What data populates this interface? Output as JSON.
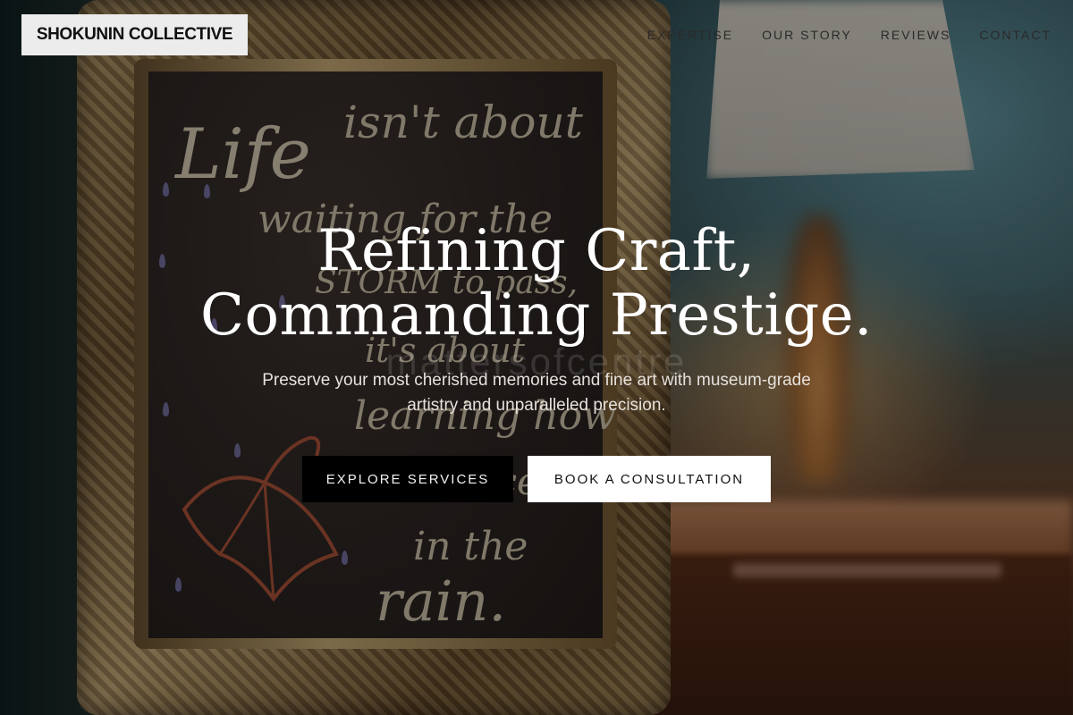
{
  "brand": {
    "name": "SHOKUNIN COLLECTIVE"
  },
  "nav": {
    "items": [
      {
        "label": "EXPERTISE"
      },
      {
        "label": "OUR STORY"
      },
      {
        "label": "REVIEWS"
      },
      {
        "label": "CONTACT"
      }
    ]
  },
  "hero": {
    "title_line1": "Refining Craft,",
    "title_line2": "Commanding Prestige.",
    "subtitle": "Preserve your most cherished memories and fine art with museum-grade artistry and unparalleled precision.",
    "watermark": "mattersofcentre",
    "primary_cta": "EXPLORE SERVICES",
    "secondary_cta": "BOOK A CONSULTATION"
  },
  "background_image": {
    "chalkboard_lines": [
      "Life",
      "isn't about",
      "waiting for the",
      "STORM to pass,",
      "it's about",
      "learning how",
      "to dance",
      "in the",
      "rain."
    ]
  },
  "colors": {
    "primary_button_bg": "#000000",
    "secondary_button_bg": "#ffffff",
    "logo_bg": "#ececec",
    "title_text": "#ffffff"
  }
}
